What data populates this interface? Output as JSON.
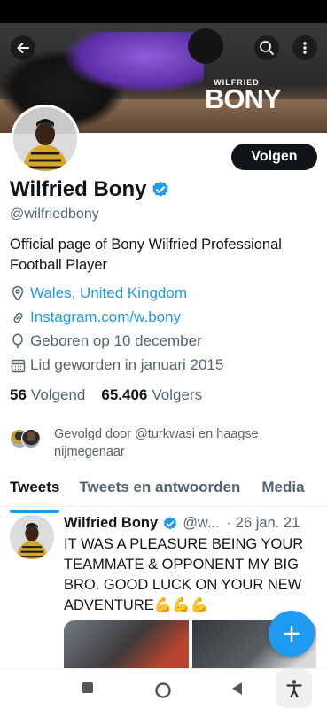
{
  "profile": {
    "display_name": "Wilfried Bony",
    "handle": "@wilfriedbony",
    "bio": "Official page of Bony Wilfried Professional Football Player",
    "location": "Wales, United Kingdom",
    "website": "Instagram.com/w.bony",
    "birthday": "Geboren op 10 december",
    "joined": "Lid geworden in januari 2015",
    "following_count": "56",
    "following_label": "Volgend",
    "followers_count": "65.406",
    "followers_label": "Volgers",
    "followed_by": "Gevolgd door @turkwasi en haagse nijmegenaar",
    "follow_button_label": "Volgen"
  },
  "banner": {
    "logo_small": "WILFRIED",
    "logo_big": "BONY"
  },
  "tabs": [
    {
      "label": "Tweets",
      "active": true
    },
    {
      "label": "Tweets en antwoorden",
      "active": false
    },
    {
      "label": "Media",
      "active": false
    }
  ],
  "tweet": {
    "name": "Wilfried Bony",
    "handle": "@w...",
    "date": "· 26 jan. 21",
    "text": "IT WAS A PLEASURE BEING YOUR TEAMMATE & OPPONENT MY BIG BRO. GOOD LUCK ON YOUR NEW ADVENTURE💪💪💪"
  },
  "icons": {
    "back": "arrow-left-icon",
    "search": "search-icon",
    "more": "more-vertical-icon",
    "location": "location-pin-icon",
    "link": "link-icon",
    "birthday": "balloon-icon",
    "calendar": "calendar-icon",
    "compose": "plus-icon"
  },
  "colors": {
    "accent": "#1d9bf0",
    "text_primary": "#0f1419",
    "text_secondary": "#536471"
  }
}
